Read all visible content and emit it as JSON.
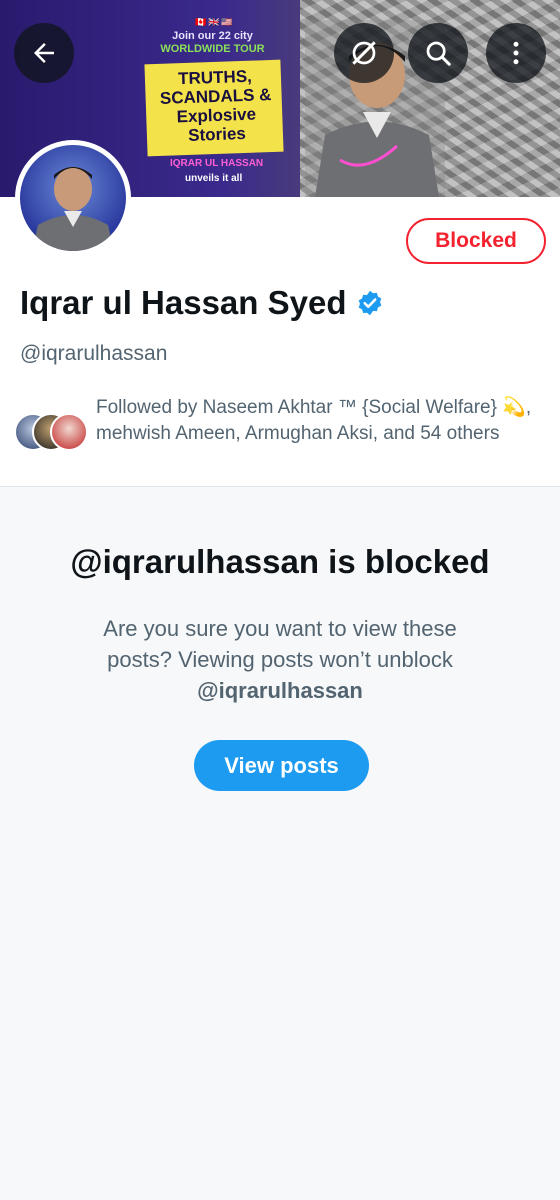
{
  "banner": {
    "join_text": "Join our 22 city",
    "tour_text": "WORLDWIDE TOUR",
    "headline": "TRUTHS, SCANDALS & Explosive Stories",
    "name_text": "IQRAR UL HASSAN",
    "unveils_text": "unveils it all"
  },
  "toolbar": {
    "back_icon": "arrow-left-icon",
    "grok_icon": "grok-icon",
    "search_icon": "search-icon",
    "more_icon": "more-vertical-icon"
  },
  "profile": {
    "display_name": "Iqrar ul Hassan Syed",
    "handle": "@iqrarulhassan",
    "blocked_label": "Blocked",
    "followed_by": "Followed by Naseem Akhtar ™ {Social Welfare} 💫, mehwish Ameen, Armughan Aksi, and 54 others"
  },
  "blocked_section": {
    "title": "@iqrarulhassan is blocked",
    "description": "Are you sure you want to view these posts? Viewing posts won’t unblock",
    "handle": "@iqrarulhassan",
    "view_button": "View posts"
  },
  "colors": {
    "accent": "#1d9bf0",
    "blocked_red": "#f4212e",
    "secondary_text": "#536471"
  }
}
